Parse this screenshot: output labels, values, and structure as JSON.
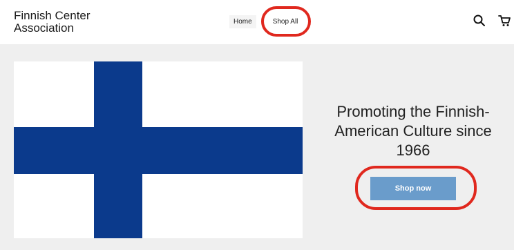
{
  "header": {
    "brand_line1": "Finnish Center",
    "brand_line2": "Association",
    "nav": [
      {
        "label": "Home"
      },
      {
        "label": "Shop All"
      }
    ],
    "icons": [
      "search-icon",
      "cart-icon"
    ]
  },
  "hero": {
    "image": "finland-flag",
    "headline": "Promoting the Finnish-American Culture since 1966",
    "cta_label": "Shop now"
  },
  "colors": {
    "flag_blue": "#0b3a8c",
    "cta_bg": "#6a9ccb",
    "annotation_red": "#e0281e",
    "hero_bg": "#efefef"
  }
}
